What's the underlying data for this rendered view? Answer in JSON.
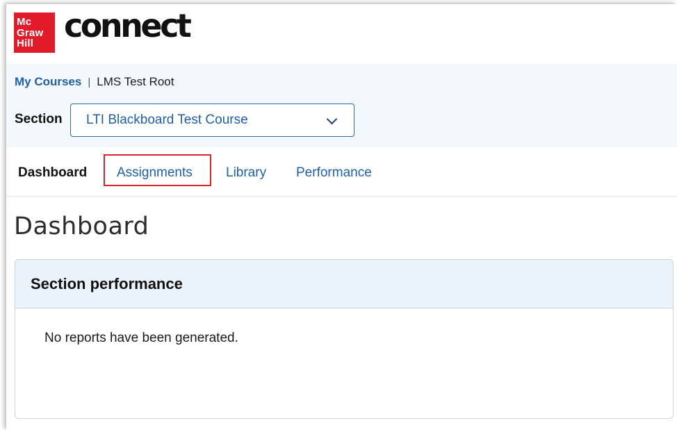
{
  "brand": {
    "logo_lines": [
      "Mc",
      "Graw",
      "Hill"
    ],
    "logo_color": "#e21b2a",
    "product_name": "connect",
    "trademark": "®"
  },
  "breadcrumb": {
    "link": "My Courses",
    "separator": "|",
    "current": "LMS Test Root"
  },
  "section": {
    "label": "Section",
    "selected_value": "LTI Blackboard Test Course",
    "dropdown_icon": "chevron-down-icon"
  },
  "tabs": [
    {
      "label": "Dashboard",
      "active": true
    },
    {
      "label": "Assignments",
      "active": false,
      "highlighted": true
    },
    {
      "label": "Library",
      "active": false
    },
    {
      "label": "Performance",
      "active": false
    }
  ],
  "page": {
    "title": "Dashboard"
  },
  "card": {
    "title": "Section performance",
    "message": "No reports have been generated."
  },
  "colors": {
    "link": "#1f5fa6",
    "highlight": "#d9232e",
    "coursebar_bg": "#f2f8fc",
    "card_header_bg": "#eaf3fa"
  }
}
